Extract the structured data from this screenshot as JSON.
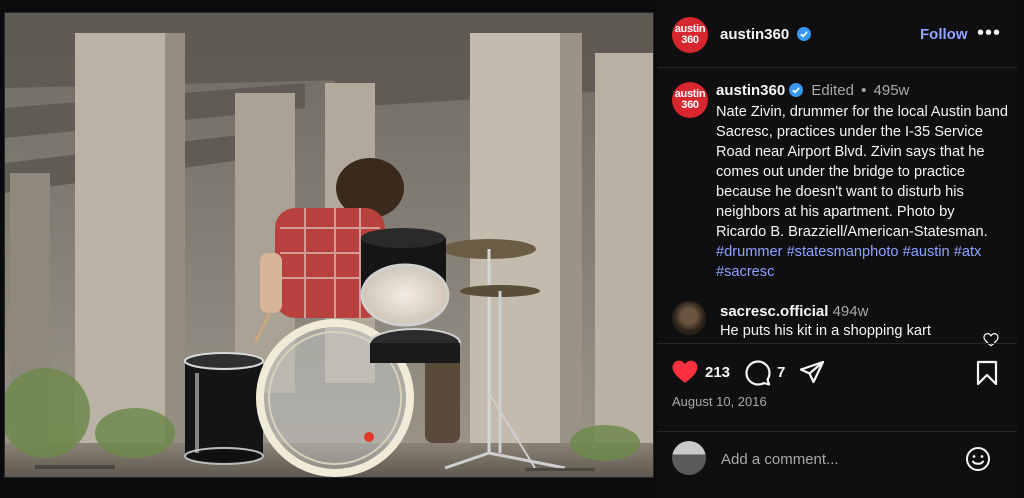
{
  "account": {
    "username": "austin360",
    "avatar_text_line1": "austin",
    "avatar_text_line2": "360",
    "follow_label": "Follow",
    "more_label": "•••"
  },
  "caption": {
    "username": "austin360",
    "edited_label": "Edited",
    "separator": "•",
    "time_ago": "495w",
    "text": "Nate Zivin, drummer for the local Austin band Sacresc, practices under the I-35 Service Road near Airport Blvd. Zivin says that he comes out under the bridge to practice because he doesn't want to disturb his neighbors at his apartment. Photo by Ricardo B. Brazziell/American-Statesman.",
    "hashtags": [
      "#drummer",
      "#statesmanphoto",
      "#austin",
      "#atx",
      "#sacresc"
    ]
  },
  "comment": {
    "username": "sacresc.official",
    "time_ago": "494w",
    "text": "He puts his kit in a shopping kart"
  },
  "actions": {
    "likes": "213",
    "comments": "7",
    "date": "August 10, 2016"
  },
  "add_comment": {
    "placeholder": "Add a comment..."
  },
  "colors": {
    "accent_link": "#8fa3ff",
    "like_red": "#ff3040",
    "brand_red": "#d8262f",
    "verified_blue": "#3797f0"
  }
}
